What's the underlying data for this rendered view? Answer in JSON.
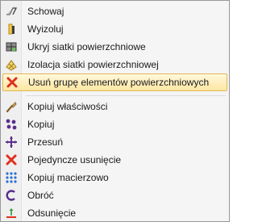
{
  "menu": {
    "items": [
      {
        "label": "Schowaj",
        "icon": "hide-icon"
      },
      {
        "label": "Wyizoluj",
        "icon": "isolate-icon"
      },
      {
        "label": "Ukryj siatki powierzchniowe",
        "icon": "hide-mesh-icon"
      },
      {
        "label": "Izolacja siatki powierzchniowej",
        "icon": "isolate-mesh-icon"
      },
      {
        "label": "Usuń grupę elementów powierzchniowych",
        "icon": "delete-x-icon",
        "highlighted": true
      },
      {
        "label": "Kopiuj właściwości",
        "icon": "brush-icon"
      },
      {
        "label": "Kopiuj",
        "icon": "copy-icon"
      },
      {
        "label": "Przesuń",
        "icon": "move-icon"
      },
      {
        "label": "Pojedyncze usunięcie",
        "icon": "single-delete-icon"
      },
      {
        "label": "Kopiuj macierzowo",
        "icon": "array-copy-icon"
      },
      {
        "label": "Obróć",
        "icon": "rotate-icon"
      },
      {
        "label": "Odsunięcie",
        "icon": "offset-icon"
      }
    ]
  },
  "colors": {
    "highlight_border": "#e3b651",
    "delete_red": "#e0301e",
    "blue": "#2b4fb5",
    "purple": "#5a2e8c"
  }
}
